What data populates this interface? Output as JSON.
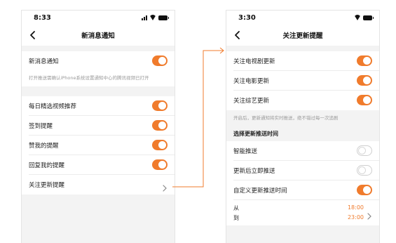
{
  "colors": {
    "accent": "#f07b2c",
    "background": "#f3f3f3",
    "connector": "#f07b2c"
  },
  "left_screen": {
    "status_time": "8:33",
    "title": "新消息通知",
    "back_icon": "chevron-left-icon",
    "rows": [
      {
        "label": "新消息通知",
        "toggle": "on"
      },
      {
        "label": "每日精选视频推荐",
        "toggle": "on"
      },
      {
        "label": "签到提醒",
        "toggle": "on"
      },
      {
        "label": "赞我的提醒",
        "toggle": "on"
      },
      {
        "label": "回复我的提醒",
        "toggle": "on"
      },
      {
        "label": "关注更新提醒",
        "icon": "chevron-right-icon"
      }
    ],
    "hint": "打开推送需确认iPhone系统设置通知中心的腾讯视频已打开"
  },
  "right_screen": {
    "status_time": "3:30",
    "title": "关注更新提醒",
    "back_icon": "chevron-left-icon",
    "rows": [
      {
        "label": "关注电视剧更新",
        "toggle": "on"
      },
      {
        "label": "关注电影更新",
        "toggle": "on"
      },
      {
        "label": "关注综艺更新",
        "toggle": "on"
      },
      {
        "label": "智能推送",
        "toggle": "off"
      },
      {
        "label": "更新后立即推送",
        "toggle": "off"
      },
      {
        "label": "自定义更新推送时间",
        "toggle": "on"
      }
    ],
    "hint": "开启后，更新通知将实时推送，绝不错过每一次追剧",
    "section_title": "选择更新推送时间",
    "time_range": {
      "from_label": "从",
      "to_label": "到",
      "from_value": "18:00",
      "to_value": "23:00"
    }
  }
}
